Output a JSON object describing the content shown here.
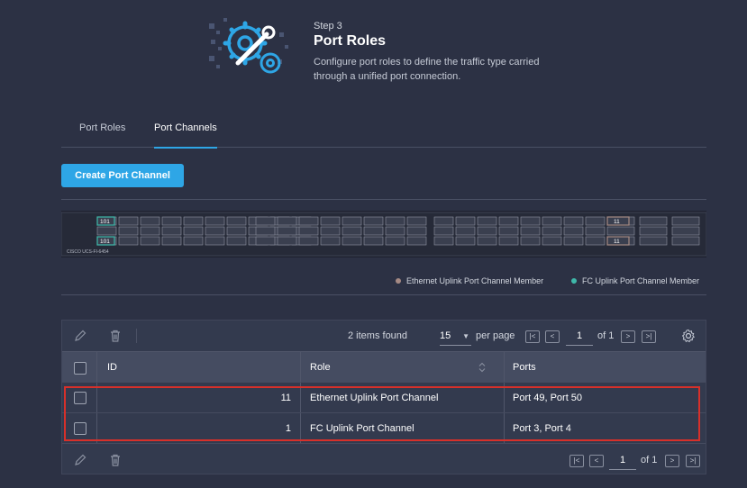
{
  "header": {
    "step": "Step 3",
    "title": "Port Roles",
    "description": "Configure port roles to define the traffic type carried through a unified port connection."
  },
  "tabs": [
    {
      "label": "Port Roles",
      "active": false
    },
    {
      "label": "Port Channels",
      "active": true
    }
  ],
  "actions": {
    "create_label": "Create Port Channel"
  },
  "switch_panel": {
    "model_label": "CISCO UCS-FI-6454",
    "fc_channel_label": "101",
    "eth_channel_label": "11"
  },
  "legend": [
    {
      "label": "Ethernet Uplink Port Channel Member",
      "color": "#a58a84"
    },
    {
      "label": "FC Uplink Port Channel Member",
      "color": "#3fb8aa"
    }
  ],
  "table": {
    "items_found": "2 items found",
    "per_page_value": "15",
    "per_page_label": "per page",
    "page": "1",
    "of_label": "of 1",
    "columns": [
      "ID",
      "Role",
      "Ports"
    ],
    "rows": [
      {
        "id": "11",
        "role": "Ethernet Uplink Port Channel",
        "ports": "Port 49, Port 50"
      },
      {
        "id": "1",
        "role": "FC Uplink Port Channel",
        "ports": "Port 3, Port 4"
      }
    ]
  },
  "colors": {
    "background": "#2c3144",
    "accent": "#2ea6e6",
    "highlight": "#d7302a"
  }
}
